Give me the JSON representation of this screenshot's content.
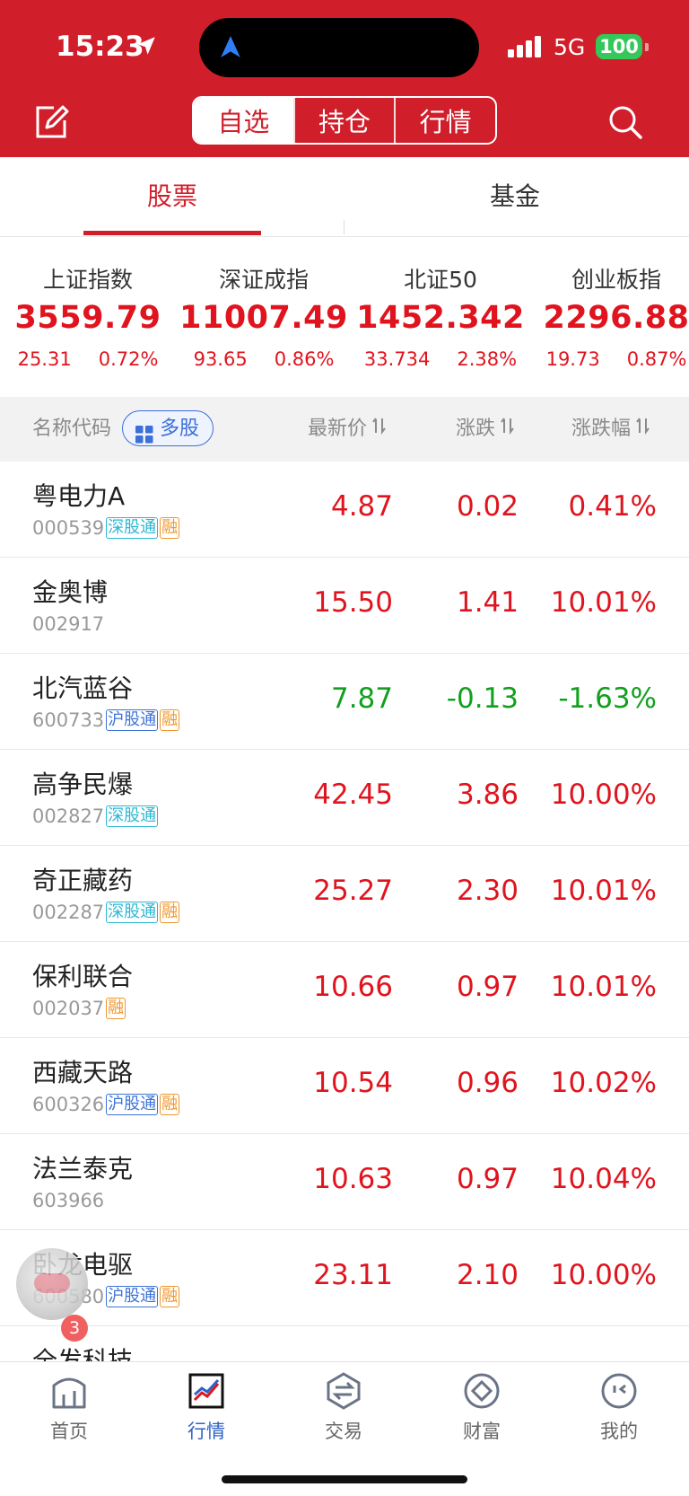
{
  "status_bar": {
    "time": "15:23",
    "network": "5G",
    "battery": "100"
  },
  "header": {
    "segments": [
      {
        "label": "自选",
        "active": true
      },
      {
        "label": "持仓",
        "active": false
      },
      {
        "label": "行情",
        "active": false
      }
    ]
  },
  "subtabs": [
    {
      "label": "股票",
      "active": true
    },
    {
      "label": "基金",
      "active": false
    }
  ],
  "indices": [
    {
      "name": "上证指数",
      "value": "3559.79",
      "change": "25.31",
      "pct": "0.72%"
    },
    {
      "name": "深证成指",
      "value": "11007.49",
      "change": "93.65",
      "pct": "0.86%"
    },
    {
      "name": "北证50",
      "value": "1452.342",
      "change": "33.734",
      "pct": "2.38%"
    },
    {
      "name": "创业板指",
      "value": "2296.88",
      "change": "19.73",
      "pct": "0.87%"
    }
  ],
  "table_header": {
    "name": "名称代码",
    "multi": "多股",
    "price": "最新价",
    "change": "涨跌",
    "pct": "涨跌幅"
  },
  "stocks": [
    {
      "name": "粤电力A",
      "code": "000539",
      "tags": [
        "深股通",
        "融"
      ],
      "price": "4.87",
      "change": "0.02",
      "pct": "0.41%",
      "direction": "up"
    },
    {
      "name": "金奥博",
      "code": "002917",
      "tags": [],
      "price": "15.50",
      "change": "1.41",
      "pct": "10.01%",
      "direction": "up"
    },
    {
      "name": "北汽蓝谷",
      "code": "600733",
      "tags": [
        "沪股通",
        "融"
      ],
      "price": "7.87",
      "change": "-0.13",
      "pct": "-1.63%",
      "direction": "down"
    },
    {
      "name": "高争民爆",
      "code": "002827",
      "tags": [
        "深股通"
      ],
      "price": "42.45",
      "change": "3.86",
      "pct": "10.00%",
      "direction": "up"
    },
    {
      "name": "奇正藏药",
      "code": "002287",
      "tags": [
        "深股通",
        "融"
      ],
      "price": "25.27",
      "change": "2.30",
      "pct": "10.01%",
      "direction": "up"
    },
    {
      "name": "保利联合",
      "code": "002037",
      "tags": [
        "融"
      ],
      "price": "10.66",
      "change": "0.97",
      "pct": "10.01%",
      "direction": "up"
    },
    {
      "name": "西藏天路",
      "code": "600326",
      "tags": [
        "沪股通",
        "融"
      ],
      "price": "10.54",
      "change": "0.96",
      "pct": "10.02%",
      "direction": "up"
    },
    {
      "name": "法兰泰克",
      "code": "603966",
      "tags": [],
      "price": "10.63",
      "change": "0.97",
      "pct": "10.04%",
      "direction": "up"
    },
    {
      "name": "卧龙电驱",
      "code": "600580",
      "tags": [
        "沪股通",
        "融"
      ],
      "price": "23.11",
      "change": "2.10",
      "pct": "10.00%",
      "direction": "up"
    }
  ],
  "partial_stock": {
    "name": "全发科技"
  },
  "assistant_badge": "3",
  "bottom_nav": [
    {
      "label": "首页",
      "icon": "home-icon",
      "active": false
    },
    {
      "label": "行情",
      "icon": "market-chart-icon",
      "active": true
    },
    {
      "label": "交易",
      "icon": "trade-icon",
      "active": false
    },
    {
      "label": "财富",
      "icon": "wealth-icon",
      "active": false
    },
    {
      "label": "我的",
      "icon": "profile-icon",
      "active": false
    }
  ],
  "colors": {
    "brand_red": "#d01f2b",
    "up": "#e0141e",
    "down": "#12a01e",
    "link_blue": "#2d63c8"
  }
}
